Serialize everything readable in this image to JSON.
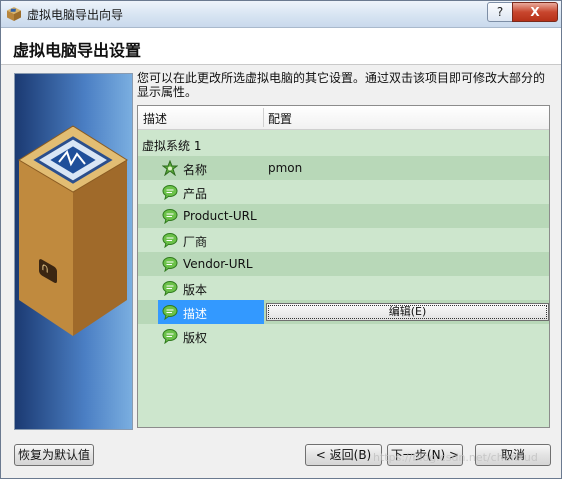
{
  "window": {
    "title": "虚拟电脑导出向导",
    "help_label": "?",
    "close_label": "X"
  },
  "header": {
    "title": "虚拟电脑导出设置"
  },
  "description": "您可以在此更改所选虚拟电脑的其它设置。通过双击该项目即可修改大部分的显示属性。",
  "table": {
    "columns": [
      "描述",
      "配置"
    ],
    "group": "虚拟系统 1",
    "rows": [
      {
        "label": "名称",
        "value": "pmon",
        "icon": "gear-star-icon"
      },
      {
        "label": "产品",
        "value": "",
        "icon": "speech-bubble-icon"
      },
      {
        "label": "Product-URL",
        "value": "",
        "icon": "speech-bubble-icon"
      },
      {
        "label": "厂商",
        "value": "",
        "icon": "speech-bubble-icon"
      },
      {
        "label": "Vendor-URL",
        "value": "",
        "icon": "speech-bubble-icon"
      },
      {
        "label": "版本",
        "value": "",
        "icon": "speech-bubble-icon"
      },
      {
        "label": "描述",
        "value": "",
        "icon": "speech-bubble-icon",
        "selected": true,
        "editor_label": "编辑(E)"
      },
      {
        "label": "版权",
        "value": "",
        "icon": "speech-bubble-icon"
      }
    ]
  },
  "buttons": {
    "restore": "恢复为默认值",
    "back": "< 返回(B)",
    "next": "下一步(N) >",
    "cancel": "取消"
  },
  "watermark": "https://blog.csdn.net/chenxud",
  "colors": {
    "tree_bg": "#cde6cd",
    "tree_alt": "#b8d8b8",
    "selection": "#3399ff"
  }
}
